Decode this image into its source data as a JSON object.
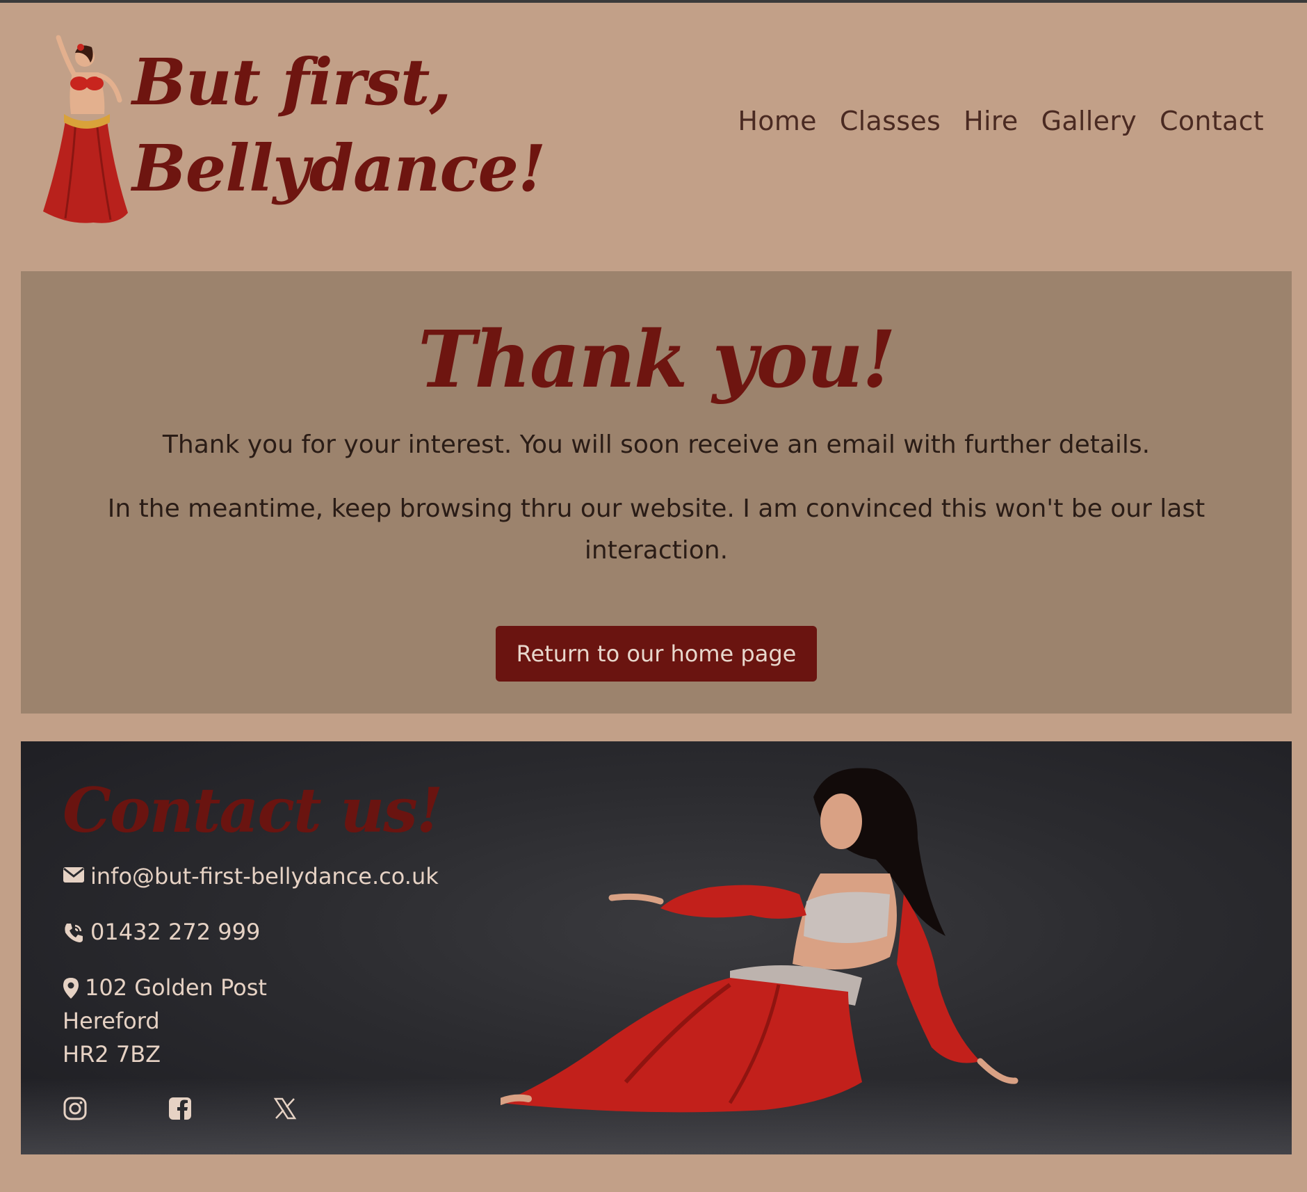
{
  "brand": {
    "line1": "But first,",
    "line2": "Bellydance!",
    "logo_icon": "bellydancer-illustration-icon"
  },
  "nav": {
    "items": [
      {
        "label": "Home"
      },
      {
        "label": "Classes"
      },
      {
        "label": "Hire"
      },
      {
        "label": "Gallery"
      },
      {
        "label": "Contact"
      }
    ]
  },
  "thankyou": {
    "title": "Thank you!",
    "paragraph1": "Thank you for your interest. You will soon receive an email with further details.",
    "paragraph2": "In the meantime, keep browsing thru our website. I am convinced this won't be our last interaction.",
    "button_label": "Return to our home page"
  },
  "contact": {
    "title": "Contact us!",
    "email": "info@but-first-bellydance.co.uk",
    "phone": "01432 272 999",
    "address": {
      "line1": "102 Golden Post",
      "line2": "Hereford",
      "line3": "HR2 7BZ"
    },
    "socials": [
      {
        "icon": "instagram-icon"
      },
      {
        "icon": "facebook-icon"
      },
      {
        "icon": "x-twitter-icon"
      }
    ],
    "photo": "reclining-bellydancer-photo"
  },
  "colors": {
    "page_bg": "#c2a088",
    "panel_bg": "#9c836d",
    "accent": "#6e1510",
    "footer_bg": "#2b2b2f",
    "footer_text": "#e6d2c4"
  }
}
